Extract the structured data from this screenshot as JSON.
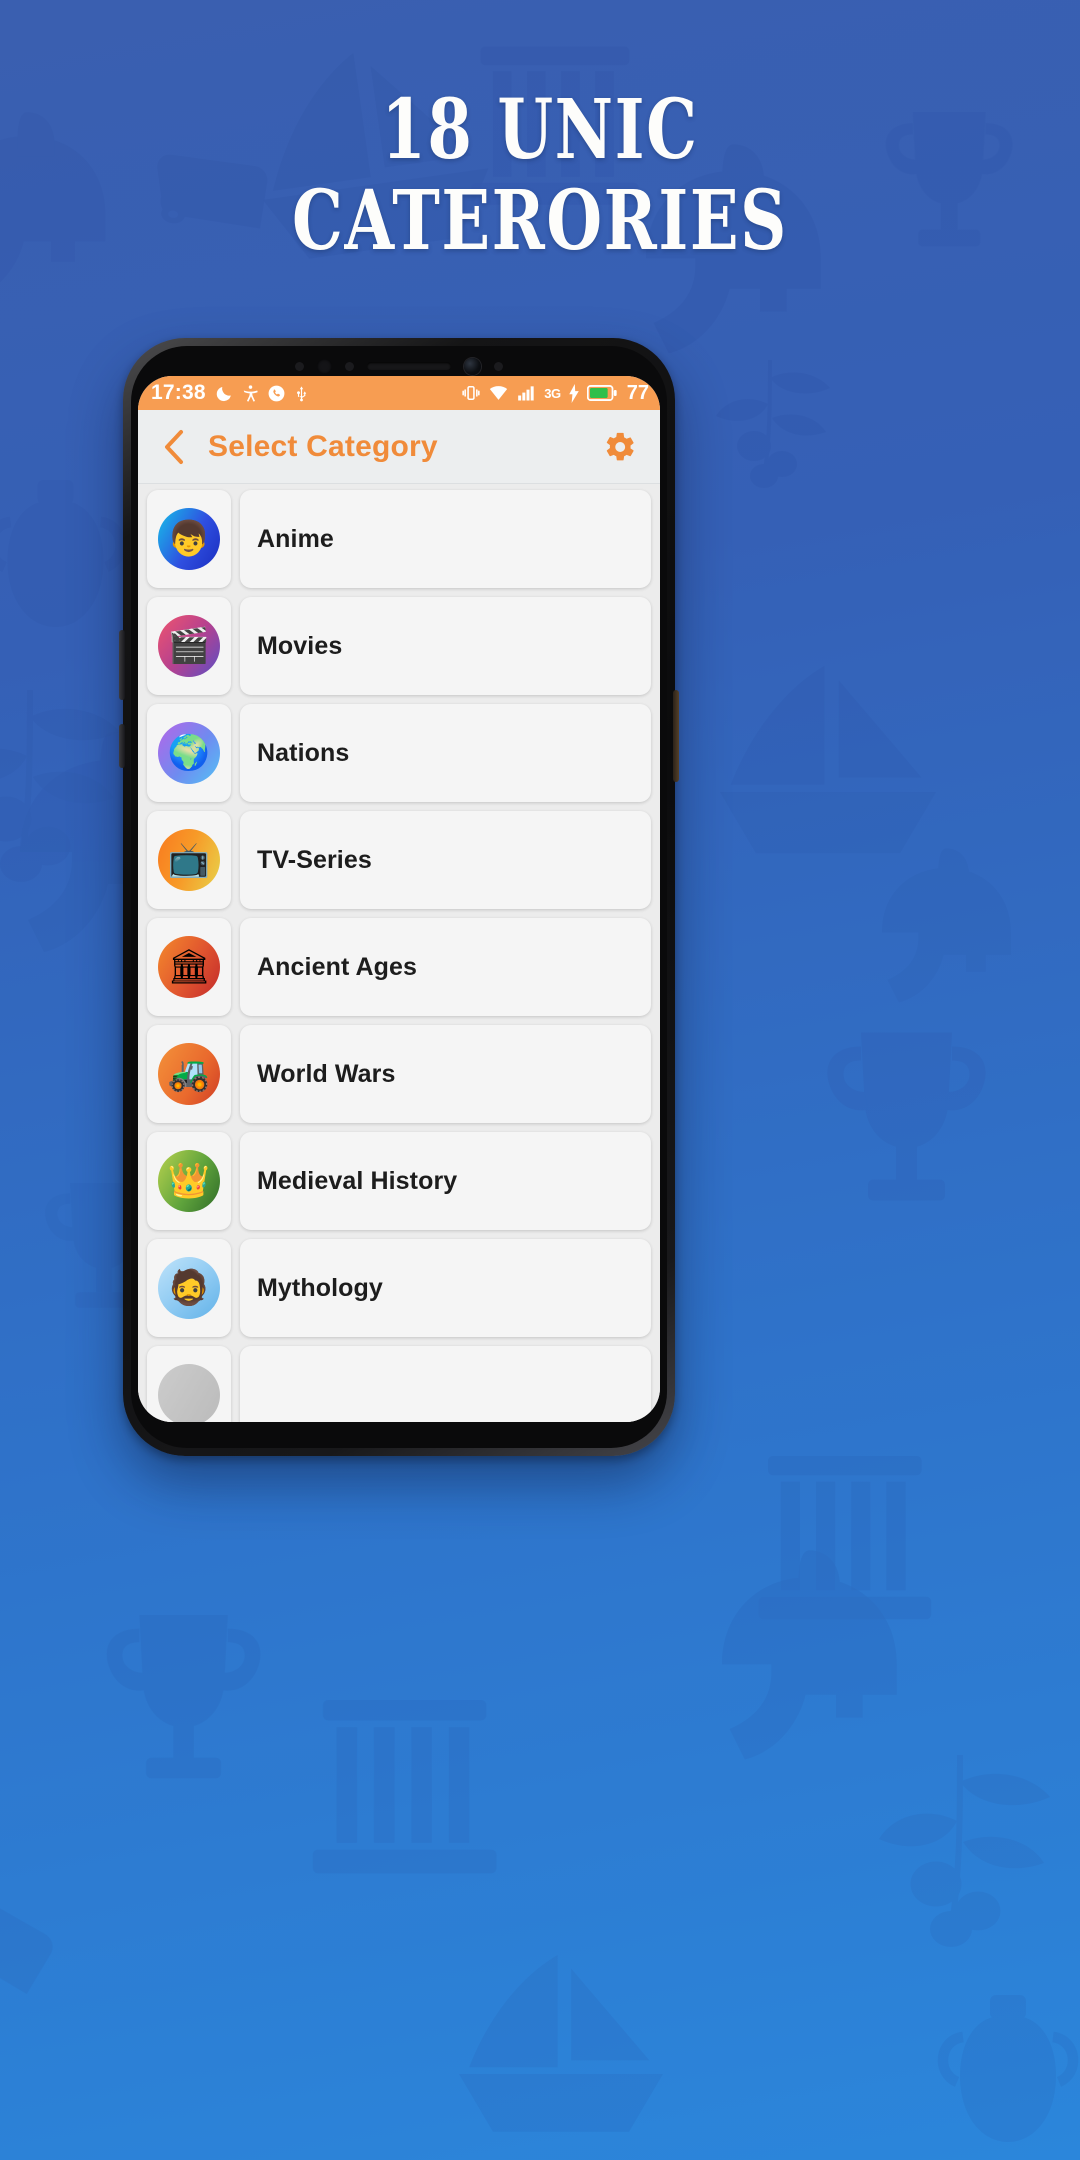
{
  "promo": {
    "headline_line1": "18 UNIC",
    "headline_line2": "CATERORIES",
    "bg_color": "#3560b6",
    "accent_color": "#f08b3a"
  },
  "status_bar": {
    "time": "17:38",
    "battery_percent": "77",
    "network_type": "3G",
    "icons": [
      "moon-icon",
      "accessibility-icon",
      "call-icon",
      "usb-icon",
      "vibrate-icon",
      "wifi-icon",
      "signal-icon",
      "charging-bolt-icon",
      "battery-icon"
    ]
  },
  "app_bar": {
    "back_label": "back-icon",
    "title": "Select Category",
    "settings_label": "gear-icon"
  },
  "categories": [
    {
      "label": "Anime",
      "emblem": "👦",
      "bg": "linear-gradient(120deg,#16c0e9 0%,#2f4fe0 55%,#1a2ec0 100%)"
    },
    {
      "label": "Movies",
      "emblem": "🎬",
      "bg": "linear-gradient(130deg,#f0556d 0%,#b6418f 50%,#5a4fc4 100%)"
    },
    {
      "label": "Nations",
      "emblem": "🌍",
      "bg": "linear-gradient(130deg,#b565e8 0%,#6f8bf0 55%,#54c2f5 100%)"
    },
    {
      "label": "TV-Series",
      "emblem": "📺",
      "bg": "linear-gradient(110deg,#f97a1f 0%,#f79a28 48%,#e8d24a 100%)"
    },
    {
      "label": "Ancient Ages",
      "emblem": "🏛",
      "bg": "linear-gradient(120deg,#f4892c 0%,#e0542f 55%,#c32b2b 100%)"
    },
    {
      "label": "World Wars",
      "emblem": "🚜",
      "bg": "linear-gradient(120deg,#f4923a 0%,#e9692d 60%,#cf3d26 100%)"
    },
    {
      "label": "Medieval History",
      "emblem": "👑",
      "bg": "linear-gradient(120deg,#b8d24e 0%,#5fa33c 55%,#2f6b28 100%)"
    },
    {
      "label": "Mythology",
      "emblem": "🧔",
      "bg": "linear-gradient(140deg,#bfe3fa 0%,#8cc9f2 55%,#62b2e8 100%)"
    },
    {
      "label": "",
      "emblem": "",
      "bg": "linear-gradient(120deg,#cccccc,#bbbbbb)"
    }
  ]
}
